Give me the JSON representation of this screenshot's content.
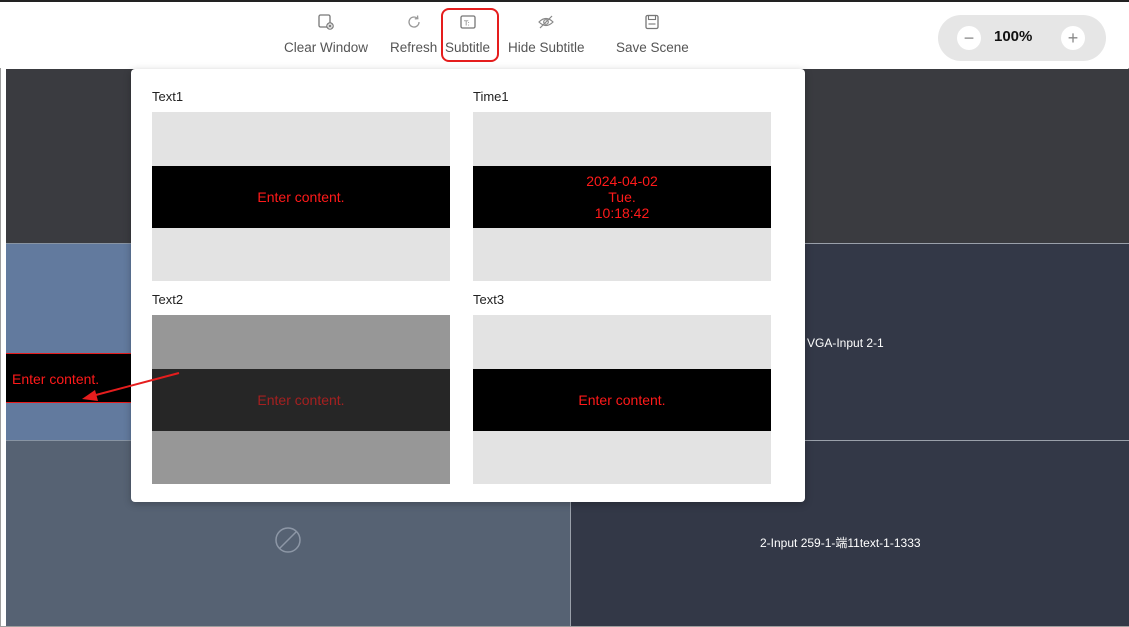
{
  "toolbar": {
    "items": [
      {
        "label": "Clear Window",
        "icon": "clear-window-icon"
      },
      {
        "label": "Refresh",
        "icon": "refresh-icon"
      },
      {
        "label": "Subtitle",
        "icon": "subtitle-icon"
      },
      {
        "label": "Hide Subtitle",
        "icon": "hide-subtitle-icon"
      },
      {
        "label": "Save Scene",
        "icon": "save-icon"
      }
    ],
    "zoom": {
      "value": "100%",
      "minus": "−",
      "plus": "+"
    }
  },
  "windows": {
    "vga_label": "VGA-Input 2-1",
    "input259_label": "2-Input 259-1-端11text-1-1333",
    "subtitle_text": "Enter content."
  },
  "popup": {
    "cards": [
      {
        "title": "Text1",
        "lines": [
          "Enter content."
        ]
      },
      {
        "title": "Time1",
        "lines": [
          "2024-04-02",
          "Tue.",
          "10:18:42"
        ]
      },
      {
        "title": "Text2",
        "lines": [
          "Enter content."
        ]
      },
      {
        "title": "Text3",
        "lines": [
          "Enter content."
        ]
      }
    ]
  },
  "colors": {
    "accent_red": "#e51d1d",
    "subtitle_text": "#ff1a1a",
    "window_dark": "#3a3b40",
    "window_navy": "#333847",
    "window_blue": "#627a9e",
    "window_slate": "#566273"
  }
}
